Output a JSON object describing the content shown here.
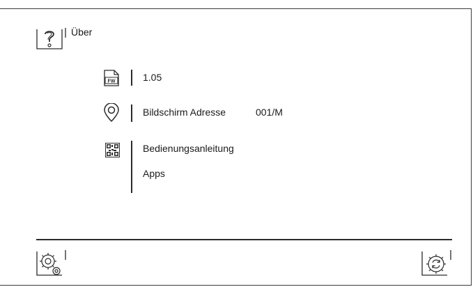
{
  "header": {
    "title": "Über",
    "help_icon": "question-mark-icon"
  },
  "firmware": {
    "icon": "firmware-file-icon",
    "icon_label": "FW",
    "version": "1.05"
  },
  "address": {
    "icon": "location-pin-icon",
    "label": "Bildschirm Adresse",
    "value": "001/M"
  },
  "links": {
    "icon": "qr-code-icon",
    "manual": "Bedienungsanleitung",
    "apps": "Apps"
  },
  "footer": {
    "left_icon": "settings-gears-icon",
    "right_icon": "settings-refresh-icon"
  }
}
